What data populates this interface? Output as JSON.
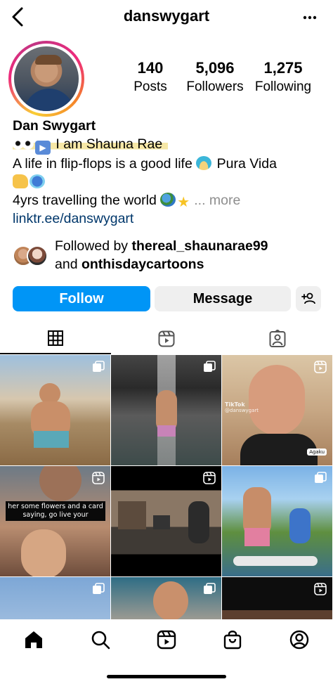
{
  "header": {
    "username": "danswygart",
    "back_icon": "chevron-left-icon",
    "more_icon": "more-horizontal-icon"
  },
  "stats": {
    "posts_count": "140",
    "posts_label": "Posts",
    "followers_count": "5,096",
    "followers_label": "Followers",
    "following_count": "1,275",
    "following_label": "Following"
  },
  "bio": {
    "name": "Dan Swygart",
    "line1_text": "I am Shauna Rae",
    "line1_emojis": [
      "eyes-emoji",
      "play-button-emoji"
    ],
    "line2_text": "A life in flip-flops is a good life",
    "line2_suffix": "Pura Vida",
    "line2_emojis": [
      "desert-island-emoji",
      "thumbs-up-emoji",
      "surfer-emoji"
    ],
    "line3_text": "4yrs travelling the world",
    "line3_emojis": [
      "globe-emoji",
      "star-emoji"
    ],
    "more_label": "... more",
    "link": "linktr.ee/danswygart"
  },
  "followed_by": {
    "prefix": "Followed by",
    "user1": "thereal_shaunarae99",
    "conjunction": "and",
    "user2": "onthisdaycartoons"
  },
  "actions": {
    "follow_label": "Follow",
    "message_label": "Message",
    "add_user_icon": "add-person-icon",
    "colors": {
      "follow_bg": "#0095f6",
      "secondary_bg": "#efefef"
    }
  },
  "tabs": [
    {
      "name": "grid",
      "icon": "grid-icon",
      "active": true
    },
    {
      "name": "reels",
      "icon": "reels-icon",
      "active": false
    },
    {
      "name": "tagged",
      "icon": "tagged-person-icon",
      "active": false
    }
  ],
  "grid": {
    "posts": [
      {
        "type": "carousel"
      },
      {
        "type": "carousel"
      },
      {
        "type": "reel",
        "overlay_brand": "TikTok",
        "overlay_handle": "@danswygart",
        "overlay_tag": "Agaku"
      },
      {
        "type": "reel",
        "caption": "her some flowers and a card saying, go live your"
      },
      {
        "type": "reel"
      },
      {
        "type": "carousel"
      },
      {
        "type": "carousel"
      },
      {
        "type": "carousel"
      },
      {
        "type": "reel"
      }
    ]
  },
  "bottom_nav": [
    {
      "name": "home",
      "icon": "home-icon"
    },
    {
      "name": "search",
      "icon": "search-icon"
    },
    {
      "name": "reels",
      "icon": "reels-icon"
    },
    {
      "name": "shop",
      "icon": "shopping-bag-icon"
    },
    {
      "name": "profile",
      "icon": "profile-icon"
    }
  ]
}
